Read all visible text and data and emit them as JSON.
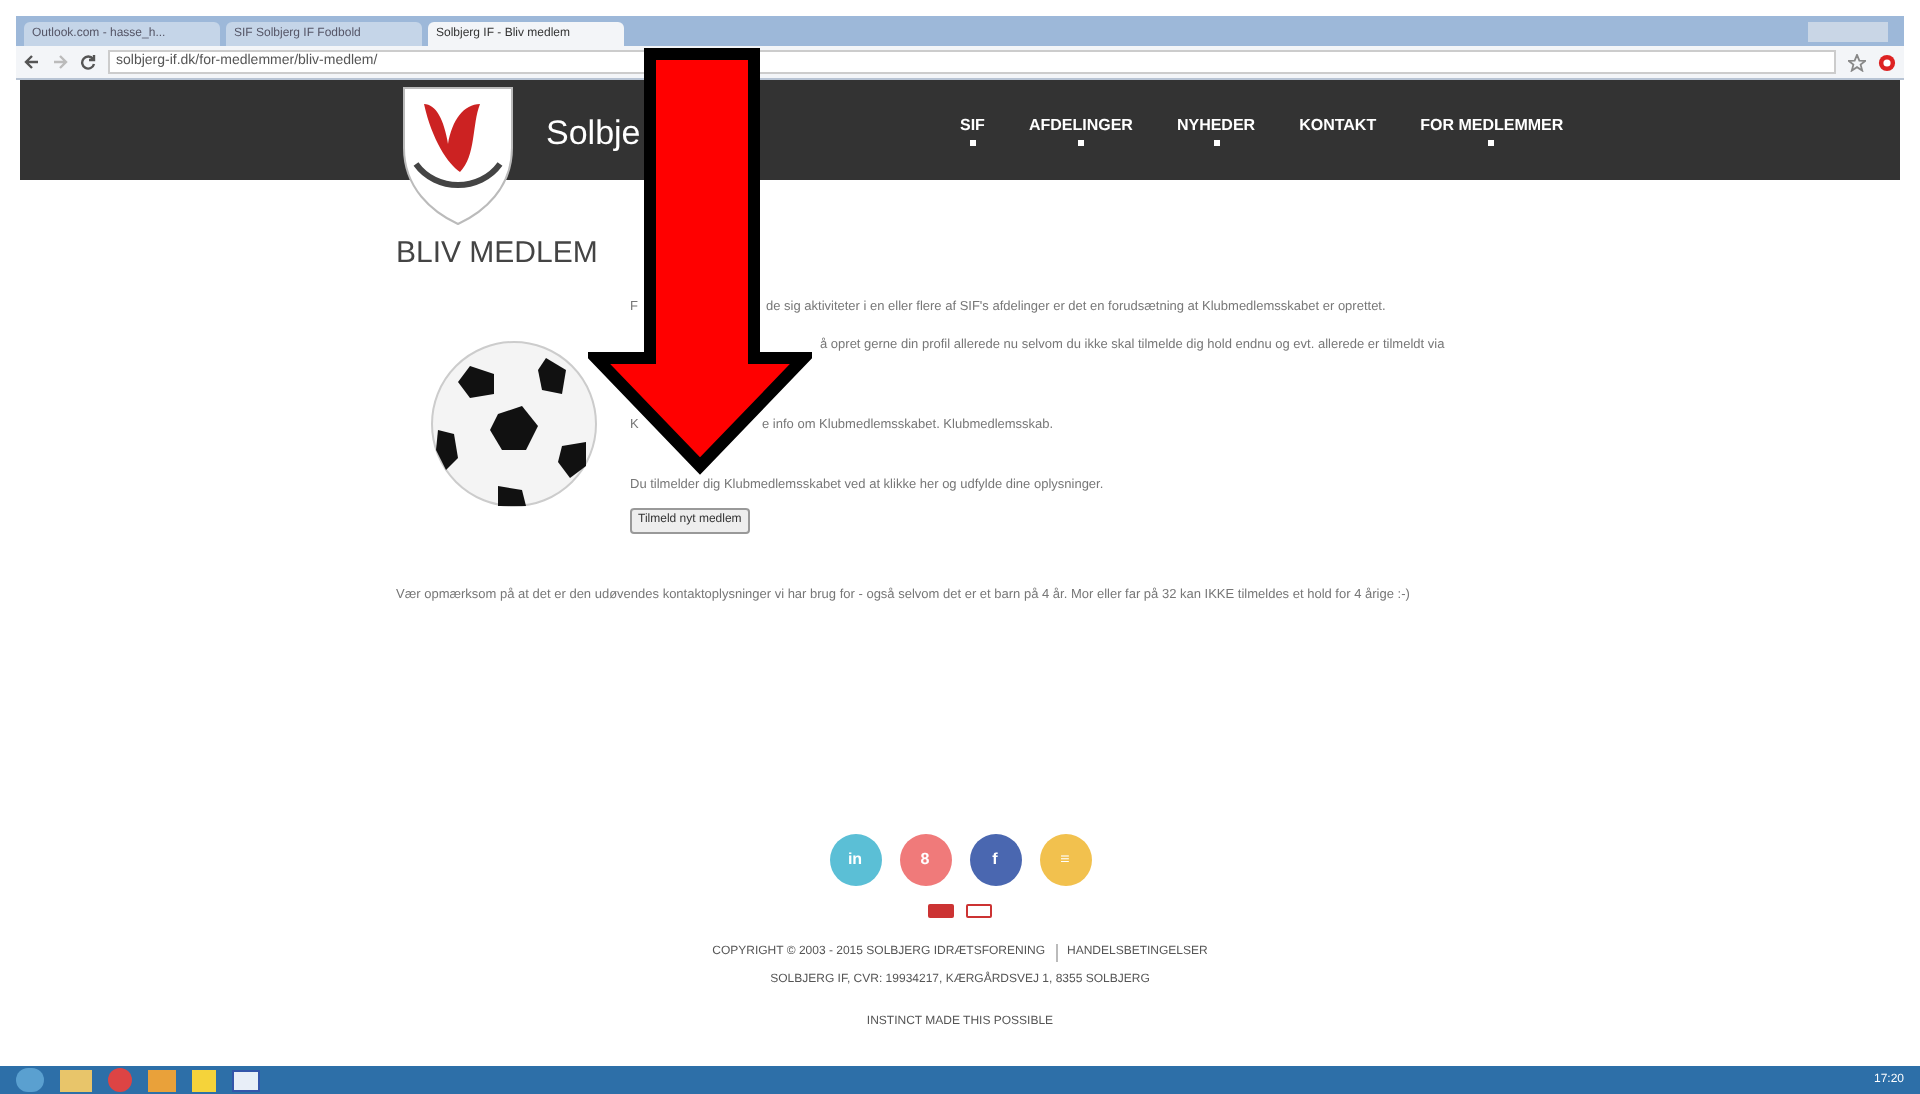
{
  "browser": {
    "tabs": [
      {
        "label": "Outlook.com - hasse_h...",
        "selected": false
      },
      {
        "label": "SIF Solbjerg IF Fodbold",
        "selected": false
      },
      {
        "label": "Solbjerg IF - Bliv medlem",
        "selected": true
      }
    ],
    "address": "solbjerg-if.dk/for-medlemmer/bliv-medlem/"
  },
  "site": {
    "logo_text": "Solbje",
    "nav": [
      {
        "label": "SIF",
        "dropdown": true
      },
      {
        "label": "AFDELINGER",
        "dropdown": true
      },
      {
        "label": "NYHEDER",
        "dropdown": true
      },
      {
        "label": "KONTAKT",
        "dropdown": false
      },
      {
        "label": "FOR MEDLEMMER",
        "dropdown": true
      }
    ]
  },
  "page": {
    "title": "BLIV MEDLEM",
    "lines": [
      {
        "before": "F",
        "after": "de sig aktiviteter i en eller flere af SIF's afdelinger er det en forudsætning at Klubmedlemsskabet er oprettet."
      },
      {
        "after": "å opret gerne din profil allerede nu selvom du ikke skal tilmelde dig hold endnu og evt. allerede er tilmeldt via"
      },
      {
        "before": "K",
        "after": "e info om Klubmedlemsskabet. Klubmedlemsskab."
      },
      {
        "after": "Du tilmelder dig Klubmedlemsskabet ved at klikke her og udfylde dine oplysninger."
      }
    ],
    "button": "Tilmeld nyt medlem",
    "notice": "Vær opmærksom på at det er den udøvendes kontaktoplysninger vi har brug for - også selvom det er et barn på 4 år. Mor eller far på 32 kan IKKE tilmeldes et hold for 4 årige :-)"
  },
  "footer": {
    "social": [
      {
        "label": "in",
        "color": "#5bbfd6"
      },
      {
        "label": "8",
        "color": "#f07a7a"
      },
      {
        "label": "f",
        "color": "#4a67b0"
      },
      {
        "label": "≡",
        "color": "#f2c14e"
      }
    ],
    "copyright": "COPYRIGHT © 2003 - 2015 SOLBJERG IDRÆTSFORENING",
    "terms": "HANDELSBETINGELSER",
    "address": "SOLBJERG IF, CVR: 19934217, KÆRGÅRDSVEJ 1, 8355 SOLBJERG",
    "credit": "INSTINCT MADE THIS POSSIBLE"
  },
  "taskbar": {
    "clock": "17:20"
  }
}
